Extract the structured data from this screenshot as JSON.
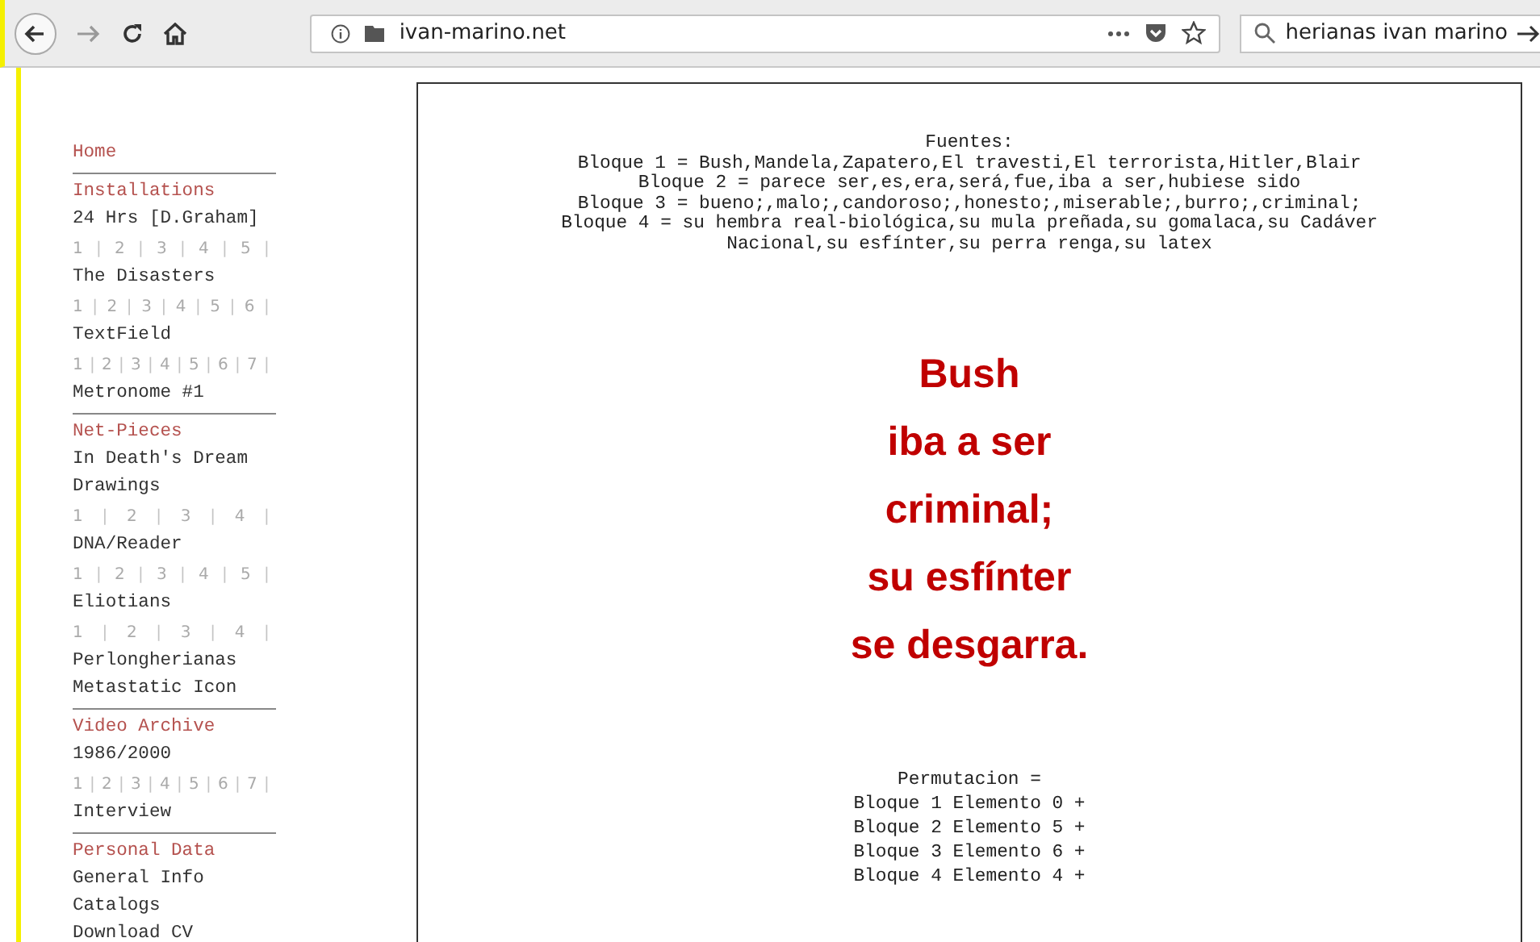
{
  "browser": {
    "url": "ivan-marino.net",
    "search": "herianas ivan marino"
  },
  "sidebar": [
    {
      "heading": "Home"
    },
    {
      "heading": "Installations",
      "items": [
        {
          "kind": "link",
          "text": "24 Hrs [D.Graham]"
        },
        {
          "kind": "pages",
          "separator": "|",
          "pages": [
            "1",
            "2",
            "3",
            "4",
            "5"
          ]
        },
        {
          "kind": "link",
          "text": "The Disasters"
        },
        {
          "kind": "pages",
          "separator": "|",
          "pages": [
            "1",
            "2",
            "3",
            "4",
            "5",
            "6"
          ]
        },
        {
          "kind": "link",
          "text": "TextField"
        },
        {
          "kind": "pages",
          "separator": "|",
          "pages": [
            "1",
            "2",
            "3",
            "4",
            "5",
            "6",
            "7"
          ]
        },
        {
          "kind": "link",
          "text": "Metronome #1"
        }
      ]
    },
    {
      "heading": "Net-Pieces",
      "items": [
        {
          "kind": "link",
          "text": "In Death's Dream"
        },
        {
          "kind": "link",
          "text": "Drawings"
        },
        {
          "kind": "pages",
          "separator": "|",
          "pages": [
            "1",
            "2",
            "3",
            "4"
          ]
        },
        {
          "kind": "link",
          "text": "DNA/Reader"
        },
        {
          "kind": "pages",
          "separator": "|",
          "pages": [
            "1",
            "2",
            "3",
            "4",
            "5"
          ]
        },
        {
          "kind": "link",
          "text": "Eliotians"
        },
        {
          "kind": "pages",
          "separator": "|",
          "pages": [
            "1",
            "2",
            "3",
            "4"
          ]
        },
        {
          "kind": "link",
          "text": "Perlongherianas"
        },
        {
          "kind": "link",
          "text": "Metastatic Icon"
        }
      ]
    },
    {
      "heading": "Video Archive",
      "items": [
        {
          "kind": "link",
          "text": "1986/2000"
        },
        {
          "kind": "pages",
          "separator": "|",
          "pages": [
            "1",
            "2",
            "3",
            "4",
            "5",
            "6",
            "7"
          ]
        },
        {
          "kind": "link",
          "text": "Interview"
        }
      ]
    },
    {
      "heading": "Personal Data",
      "items": [
        {
          "kind": "link",
          "text": "General Info"
        },
        {
          "kind": "link",
          "text": "Catalogs"
        },
        {
          "kind": "link",
          "text": "Download CV"
        }
      ]
    }
  ],
  "content": {
    "sources_title": "Fuentes:",
    "sources": [
      "Bloque 1 = Bush,Mandela,Zapatero,El travesti,El terrorista,Hitler,Blair",
      "Bloque 2 = parece ser,es,era,será,fue,iba a ser,hubiese sido",
      "Bloque 3 = bueno;,malo;,candoroso;,honesto;,miserable;,burro;,criminal;",
      "Bloque 4 = su hembra real-biológica,su mula preñada,su gomalaca,su Cadáver Nacional,su esfínter,su perra renga,su latex"
    ],
    "poem": [
      "Bush",
      "iba a ser",
      "criminal;",
      "su esfínter",
      "se desgarra."
    ],
    "permutation_title": "Permutacion =",
    "permutation": [
      "Bloque 1 Elemento 0 +",
      "Bloque 2 Elemento 5 +",
      "Bloque 3 Elemento 6 +",
      "Bloque 4 Elemento 4 +"
    ]
  }
}
